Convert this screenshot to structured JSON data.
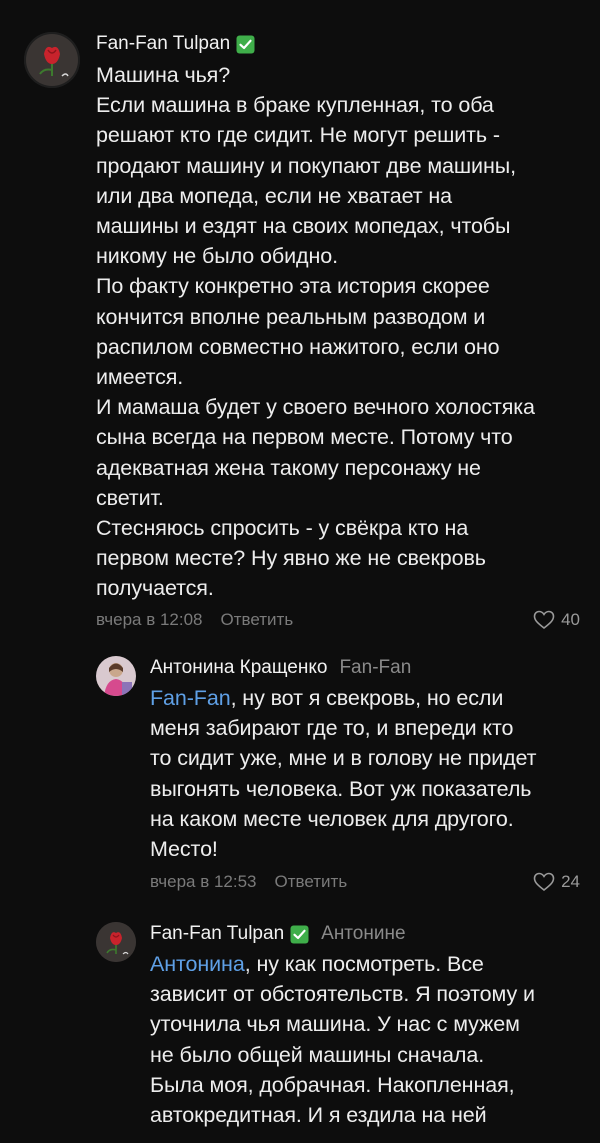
{
  "comments": [
    {
      "author": "Fan-Fan Tulpan",
      "verified": true,
      "avatar": "tulip-avatar",
      "text_lines": [
        "Машина чья?",
        "Если машина в браке купленная, то оба",
        "решают кто где сидит. Не могут решить -",
        "продают машину и покупают две машины,",
        "или два мопеда, если не хватает на",
        "машины и ездят на своих мопедах, чтобы",
        "никому не было обидно.",
        "По факту конкретно эта история скорее",
        "кончится вполне реальным разводом и",
        "распилом совместно нажитого, если оно",
        "имеется.",
        "И мамаша будет у своего вечного холостяка",
        "сына всегда на первом месте. Потому что",
        "адекватная жена такому персонажу не",
        "светит.",
        "Стесняюсь спросить - у свёкра кто на",
        "первом месте? Ну явно же не свекровь",
        "получается."
      ],
      "time": "вчера в 12:08",
      "reply_label": "Ответить",
      "likes": "40"
    },
    {
      "author": "Антонина Кращенко",
      "reply_to": "Fan-Fan",
      "avatar": "woman-avatar",
      "mention": "Fan-Fan",
      "first_line_rest": ", ну вот я свекровь, но если",
      "text_lines": [
        "меня забирают где то, и впереди кто",
        "то сидит уже, мне и в голову не придет",
        "выгонять человека. Вот уж показатель",
        "на каком месте человек для другого.",
        "Место!"
      ],
      "time": "вчера в 12:53",
      "reply_label": "Ответить",
      "likes": "24"
    },
    {
      "author": "Fan-Fan Tulpan",
      "verified": true,
      "reply_to": "Антонине",
      "avatar": "tulip-avatar",
      "mention": "Антонина",
      "first_line_rest": ", ну как посмотреть. Все",
      "text_lines": [
        "зависит от обстоятельств. Я поэтому и",
        "уточнила чья машина. У нас с мужем",
        "не было общей машины сначала.",
        "Была моя, добрачная. Накопленная,",
        "автокредитная. И я ездила на ней"
      ]
    }
  ],
  "colors": {
    "background": "#0d0d0d",
    "mention": "#5fa0e6",
    "verified": "#3fae4a",
    "muted": "#7a7a7a"
  }
}
